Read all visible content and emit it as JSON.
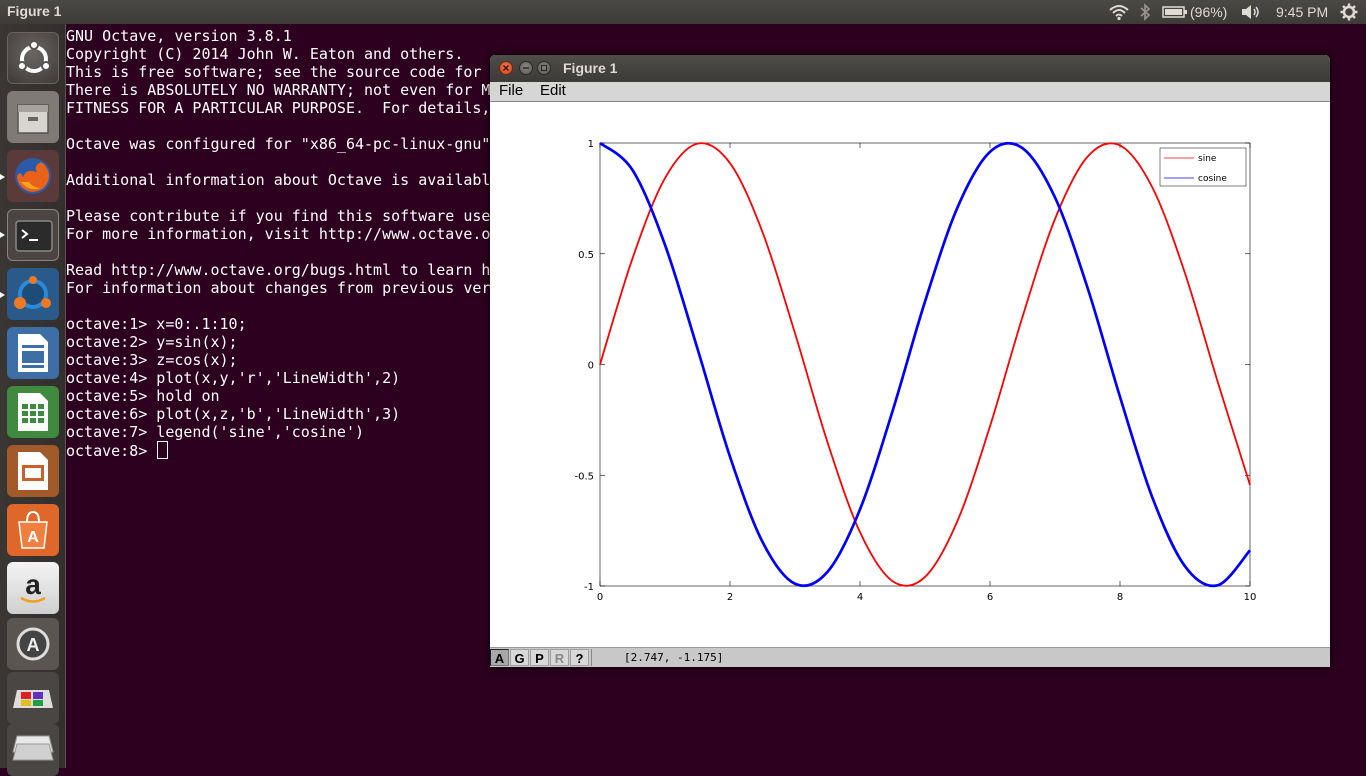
{
  "top_panel": {
    "title": "Figure 1",
    "battery": "(96%)",
    "clock": "9:45 PM",
    "icons": [
      "wifi-icon",
      "bluetooth-icon",
      "battery-icon",
      "volume-icon",
      "settings-gear-icon"
    ]
  },
  "launcher": {
    "items": [
      {
        "name": "ubuntu-dash-icon"
      },
      {
        "name": "files-icon"
      },
      {
        "name": "firefox-icon"
      },
      {
        "name": "terminal-icon"
      },
      {
        "name": "octave-icon"
      },
      {
        "name": "libreoffice-writer-icon"
      },
      {
        "name": "libreoffice-calc-icon"
      },
      {
        "name": "libreoffice-impress-icon"
      },
      {
        "name": "software-center-icon"
      },
      {
        "name": "amazon-icon"
      },
      {
        "name": "software-updater-icon"
      },
      {
        "name": "workspace-switcher-icon"
      },
      {
        "name": "trash-icon"
      }
    ]
  },
  "terminal": {
    "lines": [
      "GNU Octave, version 3.8.1",
      "Copyright (C) 2014 John W. Eaton and others.",
      "This is free software; see the source code for",
      "There is ABSOLUTELY NO WARRANTY; not even for M",
      "FITNESS FOR A PARTICULAR PURPOSE.  For details,",
      "",
      "Octave was configured for \"x86_64-pc-linux-gnu\"",
      "",
      "Additional information about Octave is availabl",
      "",
      "Please contribute if you find this software use",
      "For more information, visit http://www.octave.o",
      "",
      "Read http://www.octave.org/bugs.html to learn h",
      "For information about changes from previous ver",
      "",
      "octave:1> x=0:.1:10;",
      "octave:2> y=sin(x);",
      "octave:3> z=cos(x);",
      "octave:4> plot(x,y,'r','LineWidth',2)",
      "octave:5> hold on",
      "octave:6> plot(x,z,'b','LineWidth',3)",
      "octave:7> legend('sine','cosine')"
    ],
    "prompt": "octave:8> "
  },
  "figure": {
    "title": "Figure 1",
    "menus": [
      "File",
      "Edit"
    ],
    "toolbar_buttons": [
      "A",
      "G",
      "P",
      "R",
      "?"
    ],
    "coordinates": "[2.747, -1.175]"
  },
  "chart_data": {
    "type": "line",
    "title": "",
    "xlabel": "",
    "ylabel": "",
    "xlim": [
      0,
      10
    ],
    "ylim": [
      -1,
      1
    ],
    "xticks": [
      "0",
      "2",
      "4",
      "6",
      "8",
      "10"
    ],
    "yticks": [
      "1",
      "0.5",
      "0",
      "-0.5",
      "-1"
    ],
    "legend_position": "top-right",
    "series": [
      {
        "name": "sine",
        "color": "#ff0000",
        "line_width": 2,
        "x": [
          0,
          0.5,
          1,
          1.5,
          2,
          2.5,
          3,
          3.5,
          4,
          4.5,
          5,
          5.5,
          6,
          6.5,
          7,
          7.5,
          8,
          8.5,
          9,
          9.5,
          10
        ],
        "y": [
          0,
          0.479,
          0.841,
          0.997,
          0.909,
          0.598,
          0.141,
          -0.351,
          -0.757,
          -0.978,
          -0.959,
          -0.706,
          -0.279,
          0.215,
          0.657,
          0.938,
          0.989,
          0.798,
          0.412,
          -0.075,
          -0.544
        ]
      },
      {
        "name": "cosine",
        "color": "#0000ff",
        "line_width": 3,
        "x": [
          0,
          0.5,
          1,
          1.5,
          2,
          2.5,
          3,
          3.5,
          4,
          4.5,
          5,
          5.5,
          6,
          6.5,
          7,
          7.5,
          8,
          8.5,
          9,
          9.5,
          10
        ],
        "y": [
          1,
          0.878,
          0.54,
          0.071,
          -0.416,
          -0.801,
          -0.99,
          -0.936,
          -0.654,
          -0.211,
          0.284,
          0.709,
          0.96,
          0.977,
          0.754,
          0.347,
          -0.146,
          -0.602,
          -0.911,
          -0.997,
          -0.839
        ]
      }
    ]
  }
}
